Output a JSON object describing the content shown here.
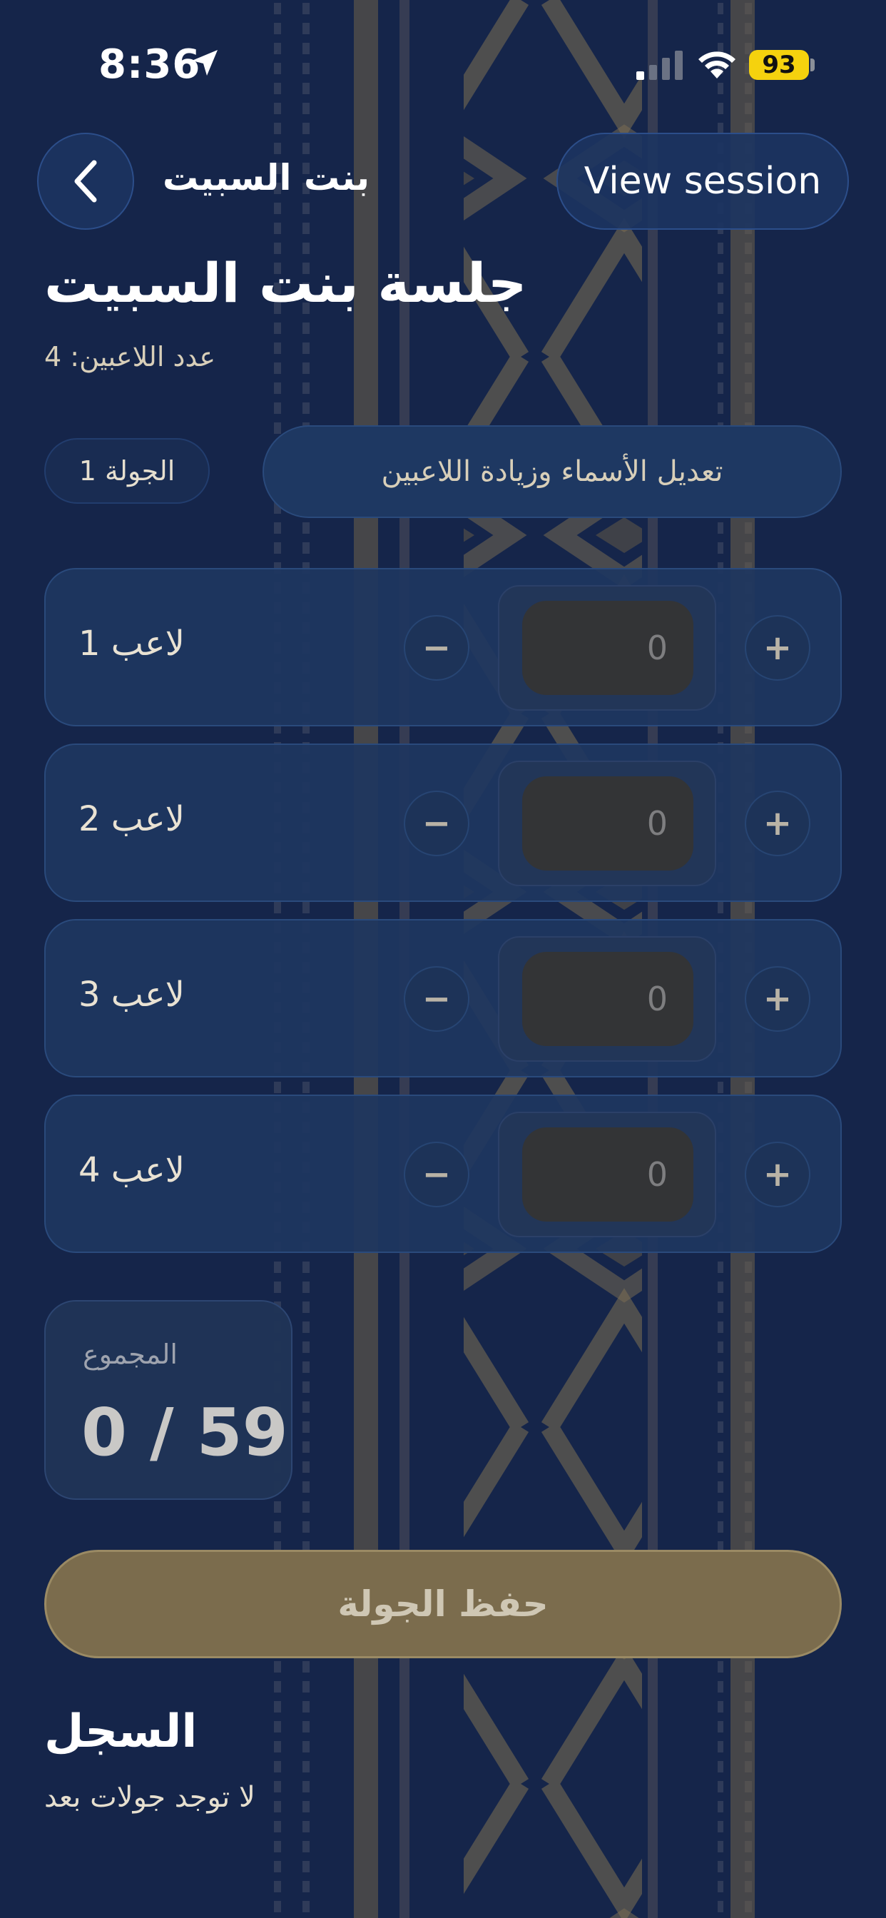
{
  "status_bar": {
    "time": "8:36",
    "battery": "93",
    "icons": [
      "location-arrow-icon",
      "cellular-signal-icon",
      "wifi-icon",
      "battery-icon"
    ]
  },
  "nav": {
    "back_icon": "chevron-left-icon",
    "title": "بنت السبيت",
    "view_session_label": "View session"
  },
  "header": {
    "title": "جلسة بنت السبيت",
    "player_count": "عدد اللاعبين: 4"
  },
  "controls": {
    "round_label": "الجولة 1",
    "edit_players_label": "تعديل الأسماء وزيادة اللاعبين"
  },
  "players": [
    {
      "name": "لاعب 1",
      "score": "0"
    },
    {
      "name": "لاعب 2",
      "score": "0"
    },
    {
      "name": "لاعب 3",
      "score": "0"
    },
    {
      "name": "لاعب 4",
      "score": "0"
    }
  ],
  "stepper": {
    "minus": "−",
    "plus": "+"
  },
  "total": {
    "label": "المجموع",
    "value": "0 / 59"
  },
  "save_label": "حفظ الجولة",
  "log": {
    "title": "السجل",
    "empty_text": "لا توجد جولات بعد"
  },
  "colors": {
    "background": "#15254a",
    "card": "#1e3660",
    "accent_gold": "#7b6c4d",
    "battery": "#f5d20e"
  }
}
